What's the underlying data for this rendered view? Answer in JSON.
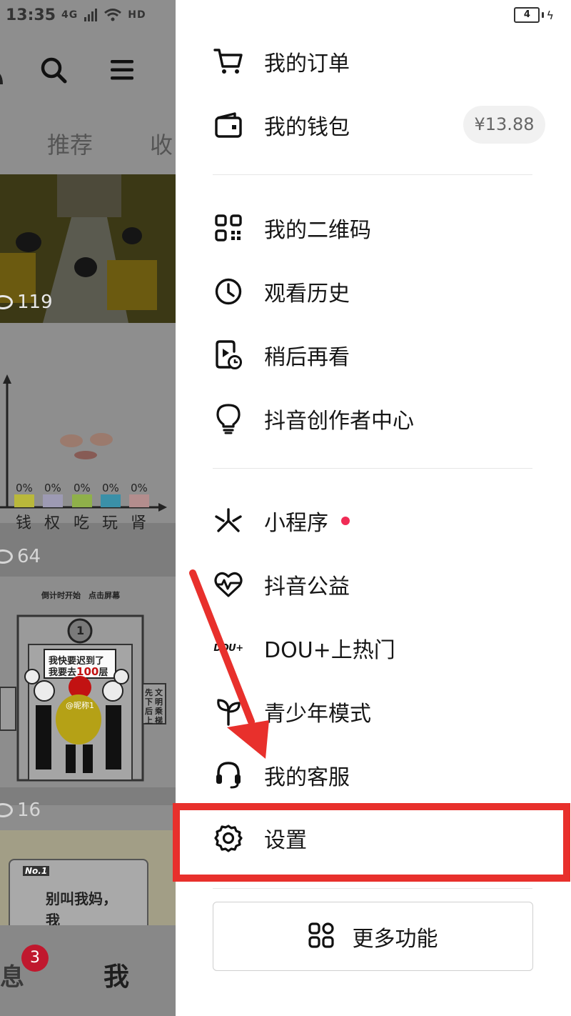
{
  "status_bar": {
    "time": "13:35",
    "network": "4G",
    "hd": "HD",
    "battery_level": "4"
  },
  "background": {
    "tabs": [
      "推荐",
      "收"
    ],
    "videos": [
      {
        "views": "119"
      },
      {
        "views": "64",
        "chart_labels": [
          "0%",
          "0%",
          "0%",
          "0%",
          "0%"
        ],
        "chart_categories": [
          "钱",
          "权",
          "吃",
          "玩",
          "肾"
        ]
      },
      {
        "views": "16",
        "caption_line1": "倒计时开始",
        "caption_line2": "点击屏幕",
        "bubble_line1": "我快要迟到了",
        "bubble_line2": "我要去",
        "bubble_number": "100",
        "bubble_suffix": "层",
        "nickname": "@昵称1",
        "side_sign": [
          "先",
          "下",
          "后",
          "上",
          "文",
          "明",
          "乘",
          "梯"
        ],
        "floor": "1"
      },
      {
        "tag": "No.1",
        "text_line1": "别叫我妈，",
        "text_line2": "我"
      }
    ],
    "bottom_nav": {
      "messages_label": "消息",
      "messages_badge": "3",
      "me_label": "我"
    }
  },
  "drawer": {
    "group1": [
      {
        "label": "我的订单",
        "icon": "cart-icon"
      },
      {
        "label": "我的钱包",
        "icon": "wallet-icon",
        "badge": "¥13.88"
      }
    ],
    "group2": [
      {
        "label": "我的二维码",
        "icon": "qrcode-icon"
      },
      {
        "label": "观看历史",
        "icon": "clock-icon"
      },
      {
        "label": "稍后再看",
        "icon": "watch-later-icon"
      },
      {
        "label": "抖音创作者中心",
        "icon": "lightbulb-icon"
      }
    ],
    "group3": [
      {
        "label": "小程序",
        "icon": "mini-program-icon",
        "has_dot": true
      },
      {
        "label": "抖音公益",
        "icon": "charity-heart-icon"
      },
      {
        "label": "DOU+上热门",
        "icon": "dou-plus-icon",
        "icon_text": "DOU+"
      },
      {
        "label": "青少年模式",
        "icon": "sprout-icon"
      },
      {
        "label": "我的客服",
        "icon": "headset-icon"
      },
      {
        "label": "设置",
        "icon": "gear-icon"
      }
    ],
    "more_button": {
      "label": "更多功能",
      "icon": "grid-icon"
    }
  },
  "colors": {
    "annotation_red": "#e8302c",
    "dot_red": "#f02b55",
    "badge_red": "#c0182e"
  }
}
